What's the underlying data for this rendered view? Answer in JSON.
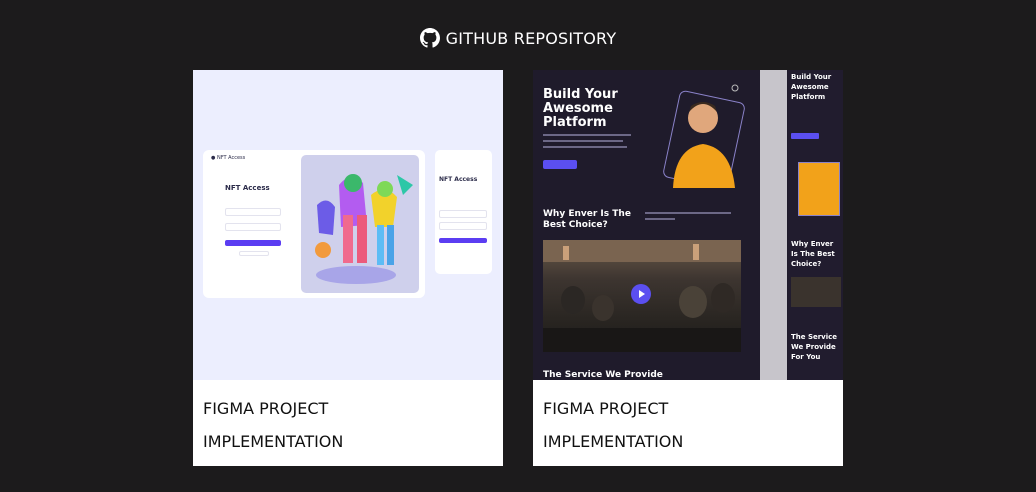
{
  "header": {
    "title": "GITHUB REPOSITORY",
    "icon": "github-icon"
  },
  "cards": [
    {
      "caption_line1": "FIGMA PROJECT",
      "caption_line2": "IMPLEMENTATION",
      "preview": {
        "heading": "NFT Access",
        "mobile_heading": "NFT Access",
        "sign_in_label": "Sign in",
        "accent": "#5b3df2",
        "background": "#eceefe"
      }
    },
    {
      "caption_line1": "FIGMA PROJECT",
      "caption_line2": "IMPLEMENTATION",
      "preview": {
        "hero_title": "Build Your Awesome Platform",
        "section_title": "Why Enver Is The Best Choice?",
        "footer_title": "The Service We Provide",
        "mini_hero_title": "Build Your Awesome Platform",
        "mini_section_title": "Why Enver Is The Best Choice?",
        "mini_footer_title": "The Service We Provide For You",
        "accent": "#5b4ff0",
        "background": "#1f1b2b",
        "shirt_color": "#f2a21a"
      }
    }
  ]
}
